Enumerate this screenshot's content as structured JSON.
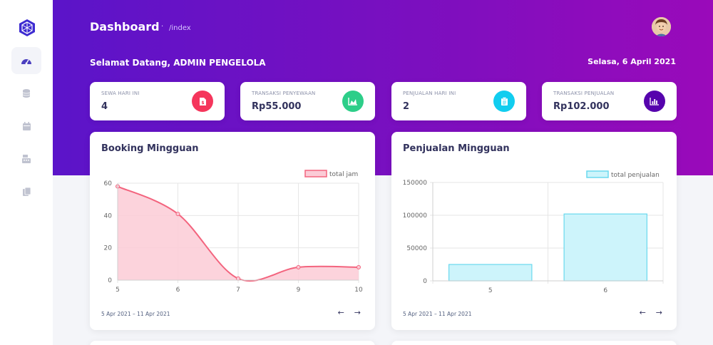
{
  "header": {
    "title": "Dashboard",
    "separator": "·",
    "breadcrumb": "/index",
    "welcome": "Selamat Datang, ADMIN PENGELOLA",
    "date": "Selasa, 6 April 2021"
  },
  "sidebar": {
    "items": [
      {
        "icon": "gauge-icon",
        "active": true
      },
      {
        "icon": "database-icon",
        "active": false
      },
      {
        "icon": "calendar-icon",
        "active": false
      },
      {
        "icon": "cash-register-icon",
        "active": false
      },
      {
        "icon": "copy-icon",
        "active": false
      }
    ]
  },
  "stats": [
    {
      "label": "SEWA HARI INI",
      "value": "4",
      "icon": "file-invoice-icon",
      "color": "#f5365c"
    },
    {
      "label": "TRANSAKSI PENYEWAAN",
      "value": "Rp55.000",
      "icon": "area-chart-icon",
      "color": "#2dce89"
    },
    {
      "label": "PENJUALAN HARI INI",
      "value": "2",
      "icon": "clipboard-icon",
      "color": "#11cdef"
    },
    {
      "label": "TRANSAKSI PENJUALAN",
      "value": "Rp102.000",
      "icon": "bar-chart-icon",
      "color": "#5603ad"
    }
  ],
  "cards": {
    "booking": {
      "title": "Booking Mingguan",
      "range": "5 Apr 2021 – 11 Apr 2021",
      "prev": "←",
      "next": "→"
    },
    "sales": {
      "title": "Penjualan Mingguan",
      "range": "5 Apr 2021 – 11 Apr 2021",
      "prev": "←",
      "next": "→"
    }
  },
  "chart_data": [
    {
      "type": "area",
      "x": [
        "5",
        "6",
        "7",
        "9",
        "10"
      ],
      "series": [
        {
          "name": "total jam",
          "values": [
            58,
            41,
            1,
            8,
            8
          ]
        }
      ],
      "ylim": [
        0,
        60
      ],
      "yticks": [
        0,
        20,
        40,
        60
      ],
      "color": "#f3647e",
      "fill": "#fbcbd6",
      "grid": true,
      "legend": "top-right"
    },
    {
      "type": "bar",
      "categories": [
        "5",
        "6"
      ],
      "series": [
        {
          "name": "total penjualan",
          "values": [
            25000,
            102000
          ]
        }
      ],
      "ylim": [
        0,
        150000
      ],
      "yticks": [
        0,
        50000,
        100000,
        150000
      ],
      "color": "#6ad9ee",
      "fill": "#cdf4fb",
      "grid": true,
      "legend": "top-right"
    }
  ]
}
